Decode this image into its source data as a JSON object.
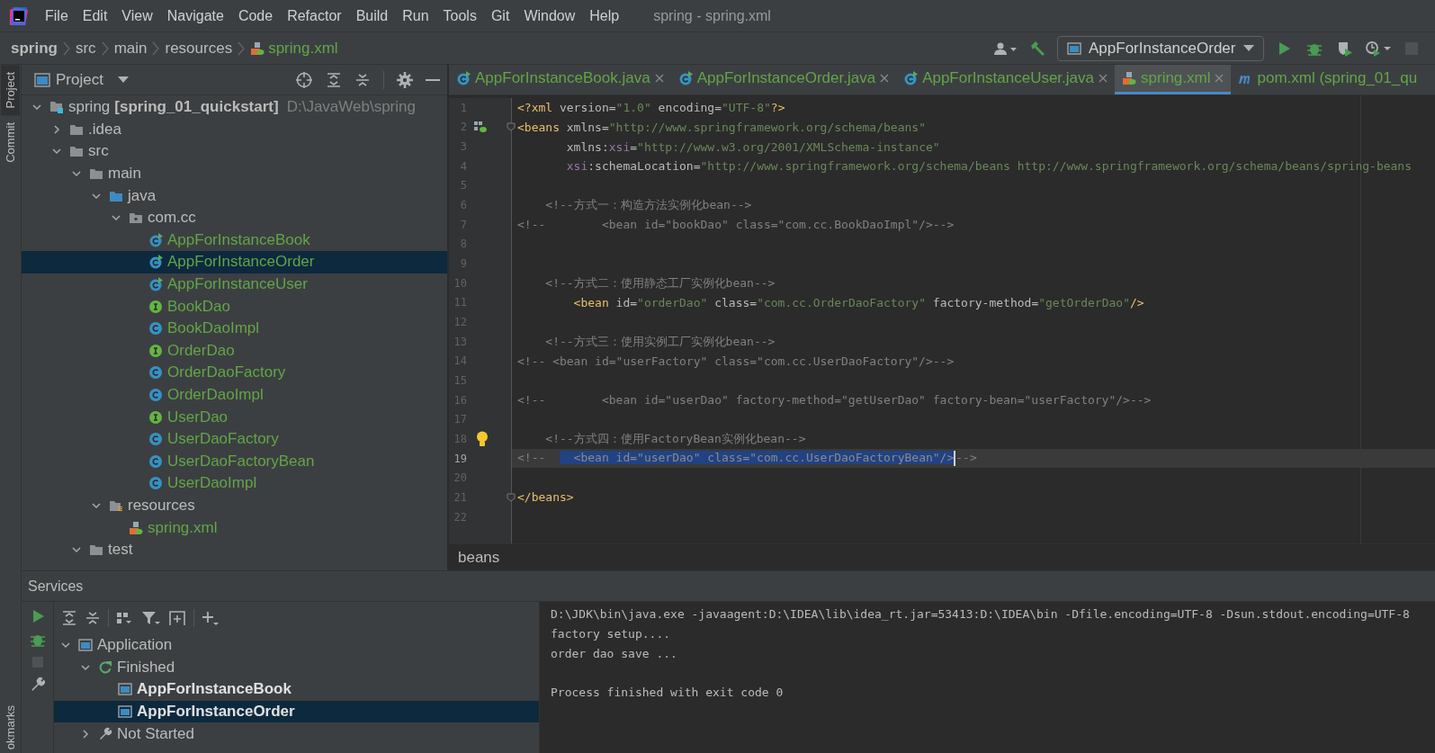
{
  "menu": {
    "items": [
      "File",
      "Edit",
      "View",
      "Navigate",
      "Code",
      "Refactor",
      "Build",
      "Run",
      "Tools",
      "Git",
      "Window",
      "Help"
    ],
    "title": "spring - spring.xml"
  },
  "breadcrumb": {
    "items": [
      {
        "label": "spring",
        "kind": "project"
      },
      {
        "label": "src",
        "kind": "folder"
      },
      {
        "label": "main",
        "kind": "folder"
      },
      {
        "label": "resources",
        "kind": "folder"
      },
      {
        "label": "spring.xml",
        "kind": "xml"
      }
    ]
  },
  "toolbar": {
    "run_config": "AppForInstanceOrder",
    "stop_disabled": true
  },
  "side_tabs": [
    {
      "label": "Project",
      "selected": true
    },
    {
      "label": "Commit",
      "selected": false
    }
  ],
  "bottom_side_tab": "okmarks",
  "project": {
    "title": "Project",
    "tree": [
      {
        "label": "spring",
        "module": "[spring_01_quickstart]",
        "path": "D:\\JavaWeb\\spring",
        "kind": "module",
        "expanded": true,
        "selected": false,
        "children": [
          {
            "label": ".idea",
            "kind": "folder",
            "expanded": false,
            "selected": false
          },
          {
            "label": "src",
            "kind": "folder",
            "expanded": true,
            "selected": false,
            "children": [
              {
                "label": "main",
                "kind": "folder",
                "expanded": true,
                "selected": false,
                "children": [
                  {
                    "label": "java",
                    "kind": "source_folder",
                    "expanded": true,
                    "selected": false,
                    "children": [
                      {
                        "label": "com.cc",
                        "kind": "package",
                        "expanded": true,
                        "selected": false,
                        "children": [
                          {
                            "label": "AppForInstanceBook",
                            "kind": "runnable_class",
                            "selected": false
                          },
                          {
                            "label": "AppForInstanceOrder",
                            "kind": "runnable_class",
                            "selected": true
                          },
                          {
                            "label": "AppForInstanceUser",
                            "kind": "runnable_class",
                            "selected": false
                          },
                          {
                            "label": "BookDao",
                            "kind": "interface",
                            "selected": false
                          },
                          {
                            "label": "BookDaoImpl",
                            "kind": "class",
                            "selected": false
                          },
                          {
                            "label": "OrderDao",
                            "kind": "interface",
                            "selected": false
                          },
                          {
                            "label": "OrderDaoFactory",
                            "kind": "class",
                            "selected": false
                          },
                          {
                            "label": "OrderDaoImpl",
                            "kind": "class",
                            "selected": false
                          },
                          {
                            "label": "UserDao",
                            "kind": "interface",
                            "selected": false
                          },
                          {
                            "label": "UserDaoFactory",
                            "kind": "class",
                            "selected": false
                          },
                          {
                            "label": "UserDaoFactoryBean",
                            "kind": "class",
                            "selected": false
                          },
                          {
                            "label": "UserDaoImpl",
                            "kind": "class",
                            "selected": false
                          }
                        ]
                      }
                    ]
                  },
                  {
                    "label": "resources",
                    "kind": "resources_folder",
                    "expanded": true,
                    "selected": false,
                    "children": [
                      {
                        "label": "spring.xml",
                        "kind": "xml",
                        "selected": false
                      }
                    ]
                  }
                ]
              },
              {
                "label": "test",
                "kind": "folder",
                "expanded": true,
                "selected": false
              }
            ]
          }
        ]
      }
    ]
  },
  "editor": {
    "tabs": [
      {
        "label": "AppForInstanceBook.java",
        "kind": "runnable_class",
        "selected": false,
        "closable": true
      },
      {
        "label": "AppForInstanceOrder.java",
        "kind": "runnable_class",
        "selected": false,
        "closable": true
      },
      {
        "label": "AppForInstanceUser.java",
        "kind": "runnable_class",
        "selected": false,
        "closable": true
      },
      {
        "label": "spring.xml",
        "kind": "xml",
        "selected": true,
        "closable": true
      },
      {
        "label": "pom.xml (spring_01_qu",
        "kind": "maven",
        "selected": false,
        "closable": false
      }
    ],
    "lines": [
      {
        "number": "1",
        "current": false,
        "kind": "plain",
        "tokens": [
          {
            "text": "<?xml",
            "kind": "tag"
          },
          {
            "text": " version=",
            "kind": "attr"
          },
          {
            "text": "\"1.0\"",
            "kind": "value"
          },
          {
            "text": " encoding=",
            "kind": "attr"
          },
          {
            "text": "\"UTF-8\"",
            "kind": "value"
          },
          {
            "text": "?>",
            "kind": "tag"
          }
        ]
      },
      {
        "number": "2",
        "current": false,
        "kind": "open_tag",
        "tokens": [
          {
            "text": "<beans",
            "kind": "tag"
          },
          {
            "text": " xmlns=",
            "kind": "attr"
          },
          {
            "text": "\"http://www.springframework.org/schema/beans\"",
            "kind": "value"
          }
        ]
      },
      {
        "number": "3",
        "current": false,
        "kind": "plain",
        "tokens": [
          {
            "text": "       xmlns:",
            "kind": "attr"
          },
          {
            "text": "xsi",
            "kind": "ns"
          },
          {
            "text": "=",
            "kind": "attr"
          },
          {
            "text": "\"http://www.w3.org/2001/XMLSchema-instance\"",
            "kind": "value"
          }
        ]
      },
      {
        "number": "4",
        "current": false,
        "kind": "plain",
        "tokens": [
          {
            "text": "       xsi",
            "kind": "ns"
          },
          {
            "text": ":schemaLocation=",
            "kind": "attr"
          },
          {
            "text": "\"http://www.springframework.org/schema/beans http://www.springframework.org/schema/beans/spring-beans",
            "kind": "value"
          }
        ]
      },
      {
        "number": "5",
        "current": false,
        "kind": "plain"
      },
      {
        "number": "6",
        "current": false,
        "kind": "plain",
        "tokens": [
          {
            "text": "    <!--方式一：构造方法实例化bean-->",
            "kind": "comment"
          }
        ]
      },
      {
        "number": "7",
        "current": false,
        "kind": "plain",
        "tokens": [
          {
            "text": "<!--        <bean id=\"bookDao\" class=\"com.cc.BookDaoImpl\"/>-->",
            "kind": "comment"
          }
        ]
      },
      {
        "number": "8",
        "current": false,
        "kind": "plain"
      },
      {
        "number": "9",
        "current": false,
        "kind": "plain"
      },
      {
        "number": "10",
        "current": false,
        "kind": "plain",
        "tokens": [
          {
            "text": "    <!--方式二：使用静态工厂实例化bean-->",
            "kind": "comment"
          }
        ]
      },
      {
        "number": "11",
        "current": false,
        "kind": "plain",
        "tokens": [
          {
            "text": "        <bean",
            "kind": "tag"
          },
          {
            "text": " id=",
            "kind": "attr"
          },
          {
            "text": "\"orderDao\"",
            "kind": "value"
          },
          {
            "text": " class=",
            "kind": "attr"
          },
          {
            "text": "\"com.cc.OrderDaoFactory\"",
            "kind": "value"
          },
          {
            "text": " factory-method=",
            "kind": "attr"
          },
          {
            "text": "\"getOrderDao\"",
            "kind": "value"
          },
          {
            "text": "/>",
            "kind": "tag"
          }
        ]
      },
      {
        "number": "12",
        "current": false,
        "kind": "plain"
      },
      {
        "number": "13",
        "current": false,
        "kind": "plain",
        "tokens": [
          {
            "text": "    <!--方式三：使用实例工厂实例化bean-->",
            "kind": "comment"
          }
        ]
      },
      {
        "number": "14",
        "current": false,
        "kind": "plain",
        "tokens": [
          {
            "text": "<!-- <bean id=\"userFactory\" class=\"com.cc.UserDaoFactory\"/>-->",
            "kind": "comment"
          }
        ]
      },
      {
        "number": "15",
        "current": false,
        "kind": "plain"
      },
      {
        "number": "16",
        "current": false,
        "kind": "plain",
        "tokens": [
          {
            "text": "<!--        <bean id=\"userDao\" factory-method=\"getUserDao\" factory-bean=\"userFactory\"/>-->",
            "kind": "comment"
          }
        ]
      },
      {
        "number": "17",
        "current": false,
        "kind": "plain"
      },
      {
        "number": "18",
        "current": false,
        "kind": "hint",
        "tokens": [
          {
            "text": "    <!--方式四：使用FactoryBean实例化bean-->",
            "kind": "comment"
          }
        ]
      },
      {
        "number": "19",
        "current": true,
        "kind": "plain",
        "tokens": [
          {
            "text": "<!--  ",
            "kind": "comment"
          },
          {
            "text": "  <bean id=\"userDao\" class=\"com.cc.UserDaoFactoryBean\"/>",
            "kind": "selection"
          },
          {
            "text": "-->",
            "kind": "comment"
          }
        ]
      },
      {
        "number": "20",
        "current": false,
        "kind": "plain"
      },
      {
        "number": "21",
        "current": false,
        "kind": "close_tag",
        "tokens": [
          {
            "text": "</beans>",
            "kind": "tag"
          }
        ]
      },
      {
        "number": "22",
        "current": false,
        "kind": "plain"
      }
    ],
    "breadcrumb": "beans"
  },
  "services": {
    "title": "Services",
    "tree": [
      {
        "label": "Application",
        "kind": "group",
        "expanded": true,
        "selected": false,
        "children": [
          {
            "label": "Finished",
            "kind": "status",
            "expanded": true,
            "selected": false,
            "children": [
              {
                "label": "AppForInstanceBook",
                "kind": "config",
                "selected": false
              },
              {
                "label": "AppForInstanceOrder",
                "kind": "config",
                "selected": true
              }
            ]
          },
          {
            "label": "Not Started",
            "kind": "idle",
            "expanded": false,
            "selected": false
          }
        ]
      }
    ],
    "console": [
      {
        "text": "D:\\JDK\\bin\\java.exe -javaagent:D:\\IDEA\\lib\\idea_rt.jar=53413:D:\\IDEA\\bin -Dfile.encoding=UTF-8 -Dsun.stdout.encoding=UTF-8",
        "kind": "output"
      },
      {
        "text": "factory setup....",
        "kind": "output"
      },
      {
        "text": "order dao save ...",
        "kind": "output"
      },
      {
        "text": "Process finished with exit code 0",
        "kind": "exit"
      }
    ]
  }
}
